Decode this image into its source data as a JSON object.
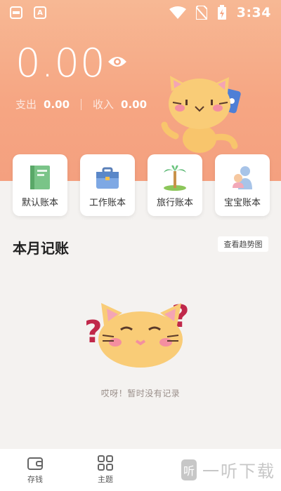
{
  "status_bar": {
    "time": "3:34",
    "app_icon_1": "A",
    "icons": [
      "wifi-icon",
      "sim-off-icon",
      "battery-charging-icon"
    ]
  },
  "hero": {
    "balance": "0.00",
    "expense_label": "支出",
    "expense_value": "0.00",
    "income_label": "收入",
    "income_value": "0.00"
  },
  "books": [
    {
      "label": "默认账本",
      "icon": "notebook-icon"
    },
    {
      "label": "工作账本",
      "icon": "briefcase-icon"
    },
    {
      "label": "旅行账本",
      "icon": "palm-tree-icon"
    },
    {
      "label": "宝宝账本",
      "icon": "baby-icon"
    }
  ],
  "month_section": {
    "title": "本月记账",
    "trend_button": "查看趋势图",
    "empty_text": "哎呀！暂时没有记录"
  },
  "tabs": [
    {
      "label": "存钱",
      "icon": "wallet-icon"
    },
    {
      "label": "主题",
      "icon": "grid-icon"
    }
  ],
  "watermark": {
    "logo": "听",
    "text": "一听下载"
  },
  "colors": {
    "hero": "#f6a683",
    "cat": "#f9c96d",
    "accent_pink": "#f48fa0",
    "question_mark": "#c0284a"
  }
}
